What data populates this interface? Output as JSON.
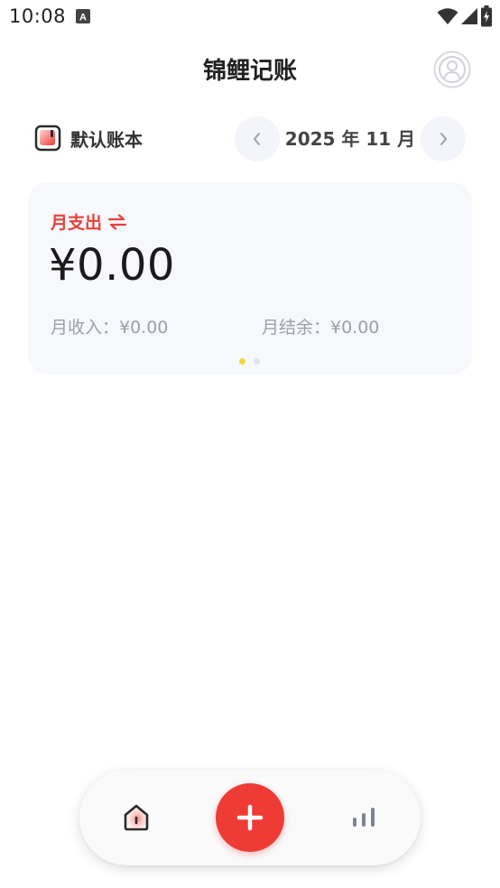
{
  "status_bar": {
    "time": "10:08",
    "icons": [
      "a-notification-icon",
      "wifi-icon",
      "cellular-signal-icon",
      "battery-charging-icon"
    ]
  },
  "header": {
    "title": "锦鲤记账",
    "profile_icon": "user-avatar-icon"
  },
  "ledger": {
    "book_name": "默认账本",
    "month_label": "2025 年 11 月",
    "prev_icon": "chevron-left-icon",
    "next_icon": "chevron-right-icon"
  },
  "summary": {
    "expense_label": "月支出",
    "expense_amount": "¥0.00",
    "income_text": "月收入：¥0.00",
    "balance_text": "月结余：¥0.00",
    "swap_icon": "swap-arrows-icon",
    "page_count": 2,
    "active_page": 0
  },
  "bottom_nav": {
    "items": [
      {
        "name": "home",
        "icon": "home-icon"
      },
      {
        "name": "add",
        "icon": "plus-icon"
      },
      {
        "name": "stats",
        "icon": "bar-chart-icon"
      }
    ]
  },
  "colors": {
    "accent_red": "#ef3b36",
    "expense_label": "#e8403a",
    "card_bg": "#f6f8fc",
    "muted_text": "#9aa0ab",
    "dot_active": "#f5d33a",
    "dot_inactive": "#dfe2e8"
  }
}
